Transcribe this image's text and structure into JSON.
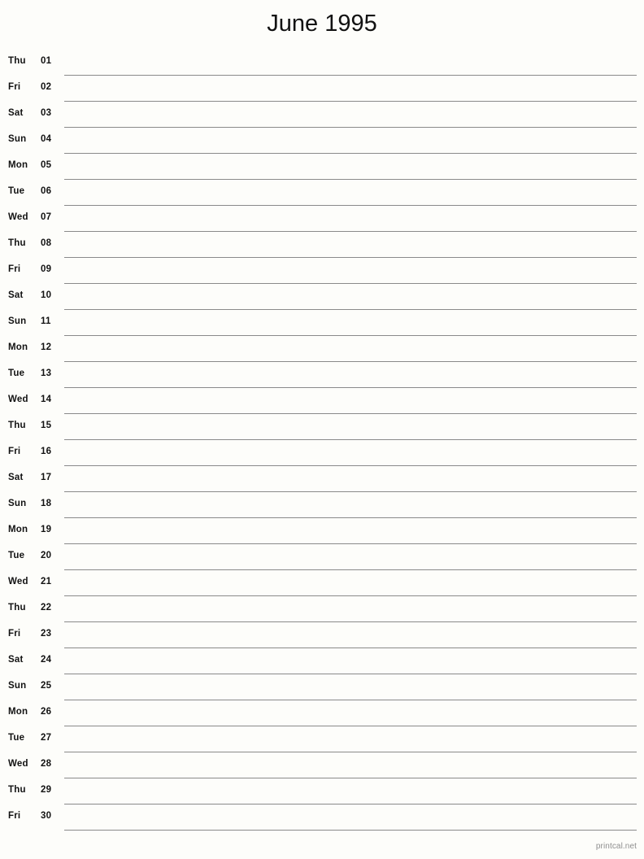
{
  "header": {
    "title": "June 1995"
  },
  "footer": {
    "watermark": "printcal.net"
  },
  "colors": {
    "background": "#fdfdfa",
    "text": "#121212",
    "rule": "#8a8a8a",
    "watermark": "#8f8f8f"
  },
  "calendar": {
    "month": "June",
    "year": "1995",
    "days": [
      {
        "weekday": "Thu",
        "date": "01"
      },
      {
        "weekday": "Fri",
        "date": "02"
      },
      {
        "weekday": "Sat",
        "date": "03"
      },
      {
        "weekday": "Sun",
        "date": "04"
      },
      {
        "weekday": "Mon",
        "date": "05"
      },
      {
        "weekday": "Tue",
        "date": "06"
      },
      {
        "weekday": "Wed",
        "date": "07"
      },
      {
        "weekday": "Thu",
        "date": "08"
      },
      {
        "weekday": "Fri",
        "date": "09"
      },
      {
        "weekday": "Sat",
        "date": "10"
      },
      {
        "weekday": "Sun",
        "date": "11"
      },
      {
        "weekday": "Mon",
        "date": "12"
      },
      {
        "weekday": "Tue",
        "date": "13"
      },
      {
        "weekday": "Wed",
        "date": "14"
      },
      {
        "weekday": "Thu",
        "date": "15"
      },
      {
        "weekday": "Fri",
        "date": "16"
      },
      {
        "weekday": "Sat",
        "date": "17"
      },
      {
        "weekday": "Sun",
        "date": "18"
      },
      {
        "weekday": "Mon",
        "date": "19"
      },
      {
        "weekday": "Tue",
        "date": "20"
      },
      {
        "weekday": "Wed",
        "date": "21"
      },
      {
        "weekday": "Thu",
        "date": "22"
      },
      {
        "weekday": "Fri",
        "date": "23"
      },
      {
        "weekday": "Sat",
        "date": "24"
      },
      {
        "weekday": "Sun",
        "date": "25"
      },
      {
        "weekday": "Mon",
        "date": "26"
      },
      {
        "weekday": "Tue",
        "date": "27"
      },
      {
        "weekday": "Wed",
        "date": "28"
      },
      {
        "weekday": "Thu",
        "date": "29"
      },
      {
        "weekday": "Fri",
        "date": "30"
      }
    ]
  }
}
